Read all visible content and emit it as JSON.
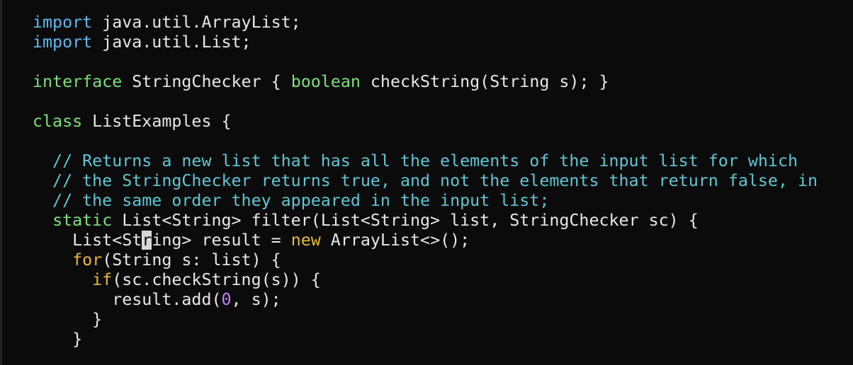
{
  "colors": {
    "background": "#0b0b0b",
    "text": "#e8e8e8",
    "keyword_import": "#5fb8f2",
    "keyword": "#7be27b",
    "comment": "#5fc7d6",
    "keyword_flow": "#e8b93a",
    "number": "#c77cff",
    "cursor": "#d8d8d8"
  },
  "editor": {
    "cursor_line": 11,
    "cursor_char": "r",
    "lines": [
      [
        {
          "t": "import",
          "c": "keyword_import"
        },
        {
          "t": " java.util.ArrayList;",
          "c": "text"
        }
      ],
      [
        {
          "t": "import",
          "c": "keyword_import"
        },
        {
          "t": " java.util.List;",
          "c": "text"
        }
      ],
      [],
      [
        {
          "t": "interface",
          "c": "keyword"
        },
        {
          "t": " StringChecker { ",
          "c": "text"
        },
        {
          "t": "boolean",
          "c": "keyword"
        },
        {
          "t": " checkString(String s); }",
          "c": "text"
        }
      ],
      [],
      [
        {
          "t": "class",
          "c": "keyword"
        },
        {
          "t": " ListExamples {",
          "c": "text"
        }
      ],
      [],
      [
        {
          "t": "  // Returns a new list that has all the elements of the input list for which",
          "c": "comment"
        }
      ],
      [
        {
          "t": "  // the StringChecker returns true, and not the elements that return false, in",
          "c": "comment"
        }
      ],
      [
        {
          "t": "  // the same order they appeared in the input list;",
          "c": "comment"
        }
      ],
      [
        {
          "t": "  ",
          "c": "text"
        },
        {
          "t": "static",
          "c": "keyword"
        },
        {
          "t": " List<String> filter(List<String> list, StringChecker sc) {",
          "c": "text"
        }
      ],
      [
        {
          "t": "    List<St",
          "c": "text"
        },
        {
          "t": "r",
          "c": "cursor"
        },
        {
          "t": "ing> result = ",
          "c": "text"
        },
        {
          "t": "new",
          "c": "keyword_flow"
        },
        {
          "t": " ArrayList<>();",
          "c": "text"
        }
      ],
      [
        {
          "t": "    ",
          "c": "text"
        },
        {
          "t": "for",
          "c": "keyword_flow"
        },
        {
          "t": "(String s: list) {",
          "c": "text"
        }
      ],
      [
        {
          "t": "      ",
          "c": "text"
        },
        {
          "t": "if",
          "c": "keyword_flow"
        },
        {
          "t": "(sc.checkString(s)) {",
          "c": "text"
        }
      ],
      [
        {
          "t": "        result.add(",
          "c": "text"
        },
        {
          "t": "0",
          "c": "number"
        },
        {
          "t": ", s);",
          "c": "text"
        }
      ],
      [
        {
          "t": "      }",
          "c": "text"
        }
      ],
      [
        {
          "t": "    }",
          "c": "text"
        }
      ]
    ]
  }
}
